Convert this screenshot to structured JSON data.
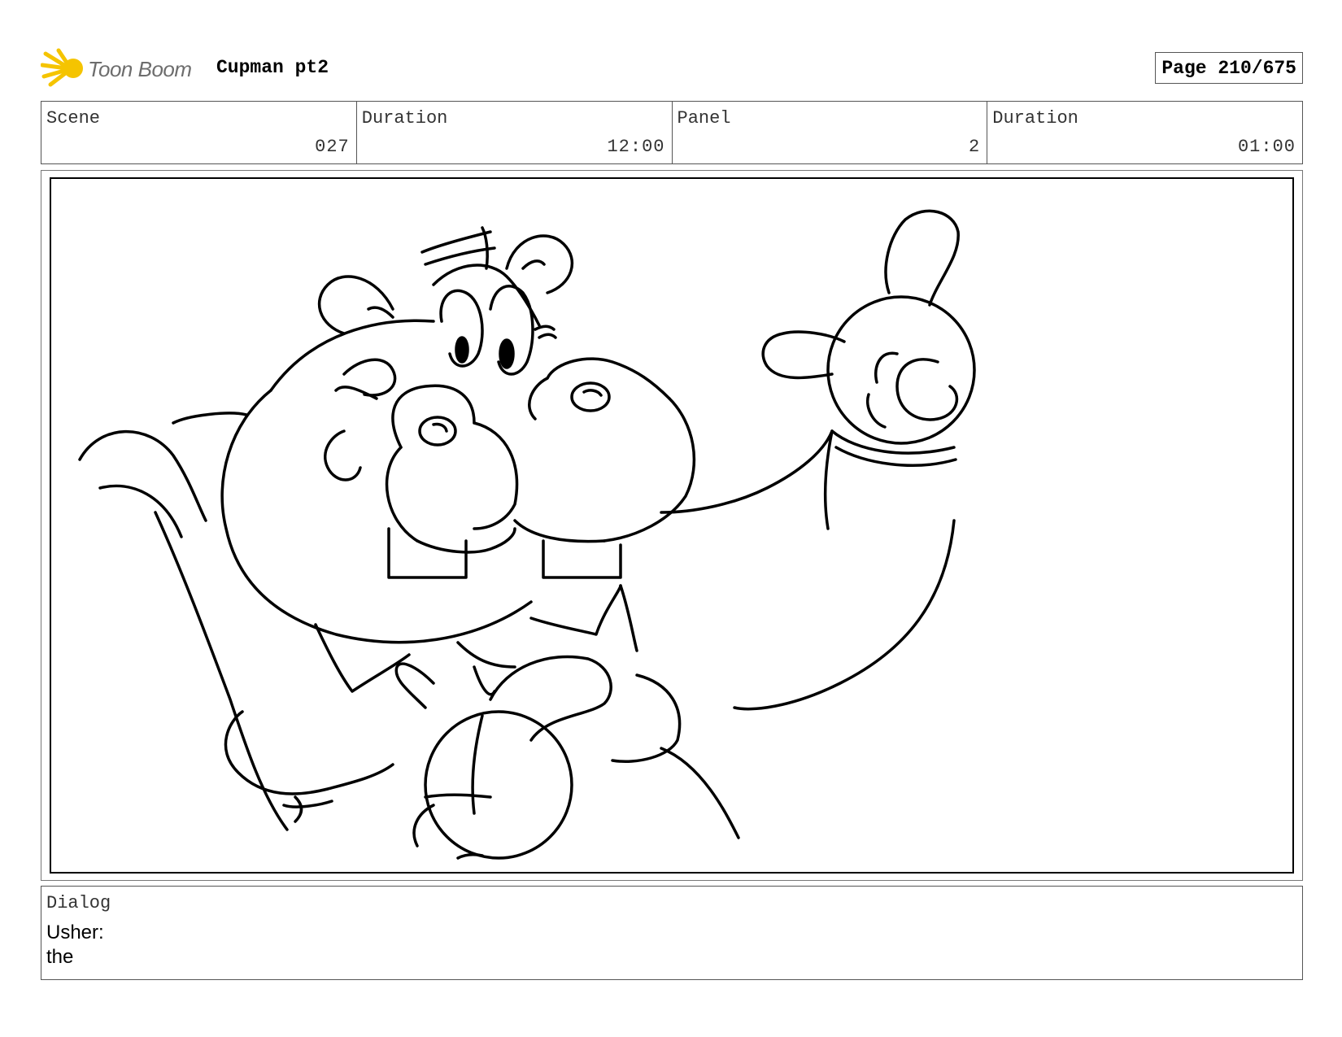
{
  "header": {
    "logo_text": "Toon Boom",
    "project_title": "Cupman pt2",
    "page_label": "Page 210/675"
  },
  "info": {
    "scene_label": "Scene",
    "scene_value": "027",
    "scene_duration_label": "Duration",
    "scene_duration_value": "12:00",
    "panel_label": "Panel",
    "panel_value": "2",
    "panel_duration_label": "Duration",
    "panel_duration_value": "01:00"
  },
  "dialog": {
    "label": "Dialog",
    "lines": [
      "Usher:",
      "the"
    ]
  },
  "colors": {
    "logo_accent": "#f5c400",
    "border": "#555555",
    "sketch_stroke": "#000000"
  }
}
